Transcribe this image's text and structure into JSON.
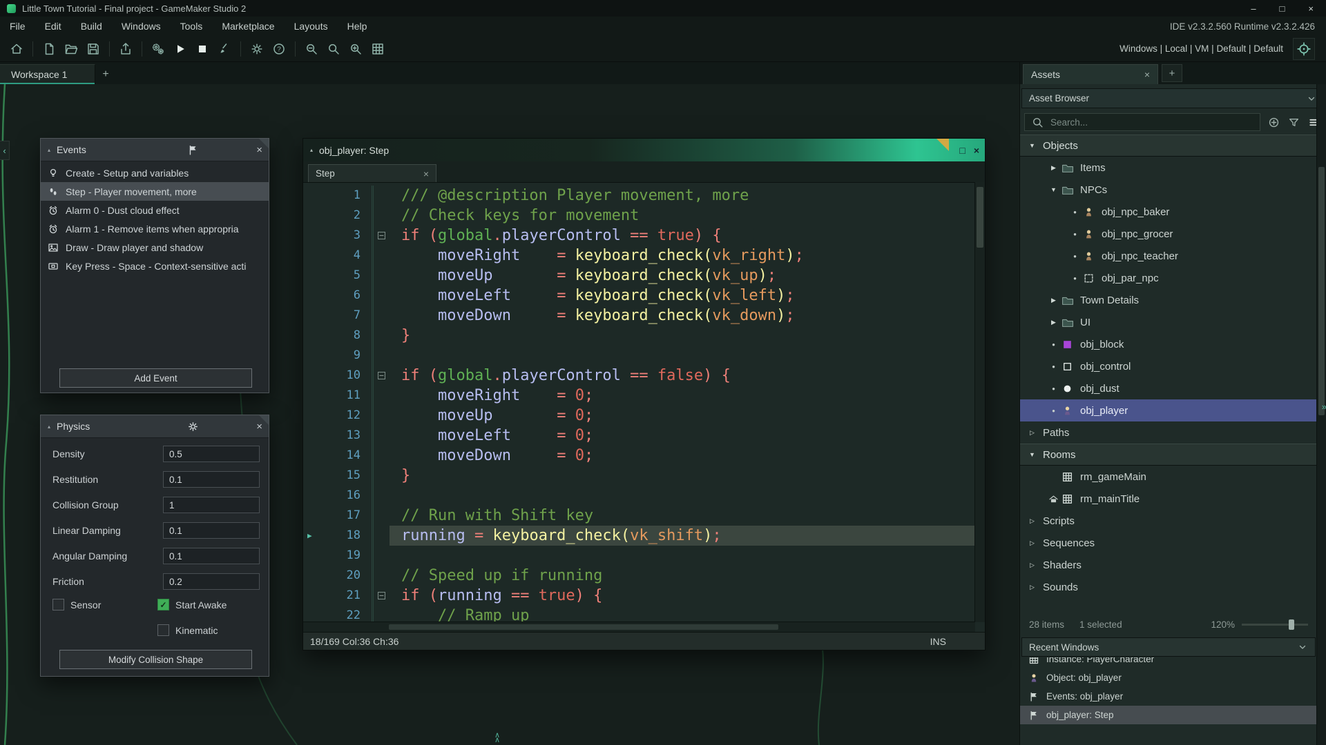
{
  "colors": {
    "accent_teal": "#2fbf97",
    "window_header_teal": "#2ec491",
    "fold_corner": "#d2a943",
    "selection_indigo": "#4a548c",
    "selection_gray": "#474d52",
    "checkbox_green": "#3fae57",
    "curve_green": "#3da15f"
  },
  "title_bar": {
    "title": "Little Town Tutorial - Final project - GameMaker Studio 2"
  },
  "menu_bar": {
    "items": [
      "File",
      "Edit",
      "Build",
      "Windows",
      "Tools",
      "Marketplace",
      "Layouts",
      "Help"
    ],
    "right_text": "IDE v2.3.2.560 Runtime v2.3.2.426"
  },
  "toolbar": {
    "groups": [
      [
        "home-icon"
      ],
      [
        "new-project-icon",
        "open-project-icon",
        "save-project-icon"
      ],
      [
        "export-icon"
      ],
      [
        "debug-gears-icon",
        "run-icon",
        "stop-icon",
        "clean-icon"
      ],
      [
        "settings-gear-icon",
        "help-icon"
      ],
      [
        "zoom-out-icon",
        "zoom-reset-icon",
        "zoom-in-icon",
        "room-editor-icon"
      ]
    ],
    "right_text": "Windows | Local | VM | Default | Default"
  },
  "workspace_tabs": {
    "active_tab": "Workspace 1",
    "add_label": "+"
  },
  "events_panel": {
    "title": "Events",
    "selected_index": 1,
    "items": [
      {
        "icon": "lightbulb-icon",
        "label": "Create - Setup and variables"
      },
      {
        "icon": "footsteps-icon",
        "label": "Step - Player movement, more"
      },
      {
        "icon": "alarm-icon",
        "label": "Alarm 0 - Dust cloud effect"
      },
      {
        "icon": "alarm-icon",
        "label": "Alarm 1 - Remove items when appropria"
      },
      {
        "icon": "draw-icon",
        "label": "Draw - Draw player and shadow"
      },
      {
        "icon": "keypress-icon",
        "label": "Key Press - Space - Context-sensitive acti"
      }
    ],
    "add_button": "Add Event"
  },
  "physics_panel": {
    "title": "Physics",
    "fields": [
      {
        "label": "Density",
        "value": "0.5"
      },
      {
        "label": "Restitution",
        "value": "0.1"
      },
      {
        "label": "Collision Group",
        "value": "1"
      },
      {
        "label": "Linear Damping",
        "value": "0.1"
      },
      {
        "label": "Angular Damping",
        "value": "0.1"
      },
      {
        "label": "Friction",
        "value": "0.2"
      }
    ],
    "checkboxes": [
      {
        "label": "Sensor",
        "checked": false
      },
      {
        "label": "Start Awake",
        "checked": true
      },
      {
        "label": "Kinematic",
        "checked": false
      }
    ],
    "modify_button": "Modify Collision Shape"
  },
  "code_window": {
    "title": "obj_player: Step",
    "tab_label": "Step",
    "status_left": "18/169 Col:36 Ch:36",
    "status_right": "INS",
    "current_line": 18,
    "syntax_colors": {
      "c": "#6fa24b",
      "k": "#ef8079",
      "g": "#5fb054",
      "v": "#b7bdf0",
      "b": "#e0695c",
      "f": "#f4f1a1",
      "o": "#e59a5e",
      "w": "#cfd8d4"
    },
    "lines": [
      {
        "n": 1,
        "segs": [
          [
            "c",
            "/// @description Player movement, more"
          ]
        ]
      },
      {
        "n": 2,
        "segs": [
          [
            "c",
            "// Check keys for movement"
          ]
        ]
      },
      {
        "n": 3,
        "fold": true,
        "segs": [
          [
            "k",
            "if ("
          ],
          [
            "g",
            "global"
          ],
          [
            "k",
            "."
          ],
          [
            "v",
            "playerControl"
          ],
          [
            "k",
            " == "
          ],
          [
            "b",
            "true"
          ],
          [
            "k",
            ") {"
          ]
        ]
      },
      {
        "n": 4,
        "segs": [
          [
            "w",
            "    "
          ],
          [
            "v",
            "moveRight"
          ],
          [
            "w",
            "    "
          ],
          [
            "k",
            "= "
          ],
          [
            "f",
            "keyboard_check("
          ],
          [
            "o",
            "vk_right"
          ],
          [
            "f",
            ")"
          ],
          [
            "k",
            ";"
          ]
        ]
      },
      {
        "n": 5,
        "segs": [
          [
            "w",
            "    "
          ],
          [
            "v",
            "moveUp"
          ],
          [
            "w",
            "       "
          ],
          [
            "k",
            "= "
          ],
          [
            "f",
            "keyboard_check("
          ],
          [
            "o",
            "vk_up"
          ],
          [
            "f",
            ")"
          ],
          [
            "k",
            ";"
          ]
        ]
      },
      {
        "n": 6,
        "segs": [
          [
            "w",
            "    "
          ],
          [
            "v",
            "moveLeft"
          ],
          [
            "w",
            "     "
          ],
          [
            "k",
            "= "
          ],
          [
            "f",
            "keyboard_check("
          ],
          [
            "o",
            "vk_left"
          ],
          [
            "f",
            ")"
          ],
          [
            "k",
            ";"
          ]
        ]
      },
      {
        "n": 7,
        "segs": [
          [
            "w",
            "    "
          ],
          [
            "v",
            "moveDown"
          ],
          [
            "w",
            "     "
          ],
          [
            "k",
            "= "
          ],
          [
            "f",
            "keyboard_check("
          ],
          [
            "o",
            "vk_down"
          ],
          [
            "f",
            ")"
          ],
          [
            "k",
            ";"
          ]
        ]
      },
      {
        "n": 8,
        "segs": [
          [
            "k",
            "}"
          ]
        ]
      },
      {
        "n": 9,
        "segs": []
      },
      {
        "n": 10,
        "fold": true,
        "segs": [
          [
            "k",
            "if ("
          ],
          [
            "g",
            "global"
          ],
          [
            "k",
            "."
          ],
          [
            "v",
            "playerControl"
          ],
          [
            "k",
            " == "
          ],
          [
            "b",
            "false"
          ],
          [
            "k",
            ") {"
          ]
        ]
      },
      {
        "n": 11,
        "segs": [
          [
            "w",
            "    "
          ],
          [
            "v",
            "moveRight"
          ],
          [
            "w",
            "    "
          ],
          [
            "k",
            "= "
          ],
          [
            "b",
            "0"
          ],
          [
            "k",
            ";"
          ]
        ]
      },
      {
        "n": 12,
        "segs": [
          [
            "w",
            "    "
          ],
          [
            "v",
            "moveUp"
          ],
          [
            "w",
            "       "
          ],
          [
            "k",
            "= "
          ],
          [
            "b",
            "0"
          ],
          [
            "k",
            ";"
          ]
        ]
      },
      {
        "n": 13,
        "segs": [
          [
            "w",
            "    "
          ],
          [
            "v",
            "moveLeft"
          ],
          [
            "w",
            "     "
          ],
          [
            "k",
            "= "
          ],
          [
            "b",
            "0"
          ],
          [
            "k",
            ";"
          ]
        ]
      },
      {
        "n": 14,
        "segs": [
          [
            "w",
            "    "
          ],
          [
            "v",
            "moveDown"
          ],
          [
            "w",
            "     "
          ],
          [
            "k",
            "= "
          ],
          [
            "b",
            "0"
          ],
          [
            "k",
            ";"
          ]
        ]
      },
      {
        "n": 15,
        "segs": [
          [
            "k",
            "}"
          ]
        ]
      },
      {
        "n": 16,
        "segs": []
      },
      {
        "n": 17,
        "segs": [
          [
            "c",
            "// Run with Shift key"
          ]
        ]
      },
      {
        "n": 18,
        "segs": [
          [
            "v",
            "running"
          ],
          [
            "k",
            " = "
          ],
          [
            "f",
            "keyboard_check("
          ],
          [
            "o",
            "vk_shift"
          ],
          [
            "f",
            ")"
          ],
          [
            "k",
            ";"
          ]
        ]
      },
      {
        "n": 19,
        "segs": []
      },
      {
        "n": 20,
        "segs": [
          [
            "c",
            "// Speed up if running"
          ]
        ]
      },
      {
        "n": 21,
        "fold": true,
        "segs": [
          [
            "k",
            "if ("
          ],
          [
            "v",
            "running"
          ],
          [
            "k",
            " == "
          ],
          [
            "b",
            "true"
          ],
          [
            "k",
            ") {"
          ]
        ]
      },
      {
        "n": 22,
        "segs": [
          [
            "w",
            "    "
          ],
          [
            "c",
            "// Ramp up"
          ]
        ]
      }
    ]
  },
  "assets_panel": {
    "tab_label": "Assets",
    "add_tab_label": "+",
    "dropdown_label": "Asset Browser",
    "search_placeholder": "Search...",
    "tree": [
      {
        "label": "Objects",
        "depth": 0,
        "kind": "section",
        "state": "expanded"
      },
      {
        "label": "Items",
        "depth": 1,
        "kind": "folder",
        "state": "collapsed",
        "icon": "folder-icon"
      },
      {
        "label": "NPCs",
        "depth": 1,
        "kind": "folder",
        "state": "expanded",
        "icon": "folder-icon"
      },
      {
        "label": "obj_npc_baker",
        "depth": 2,
        "kind": "object",
        "icon": "npc-sprite-icon"
      },
      {
        "label": "obj_npc_grocer",
        "depth": 2,
        "kind": "object",
        "icon": "npc-sprite-icon"
      },
      {
        "label": "obj_npc_teacher",
        "depth": 2,
        "kind": "object",
        "icon": "npc-sprite-icon"
      },
      {
        "label": "obj_par_npc",
        "depth": 2,
        "kind": "object",
        "icon": "blank-sprite-icon"
      },
      {
        "label": "Town Details",
        "depth": 1,
        "kind": "folder",
        "state": "collapsed",
        "icon": "folder-icon"
      },
      {
        "label": "UI",
        "depth": 1,
        "kind": "folder",
        "state": "collapsed",
        "icon": "folder-icon"
      },
      {
        "label": "obj_block",
        "depth": 1,
        "kind": "object",
        "icon": "purple-square-icon"
      },
      {
        "label": "obj_control",
        "depth": 1,
        "kind": "object",
        "icon": "outline-square-icon"
      },
      {
        "label": "obj_dust",
        "depth": 1,
        "kind": "object",
        "icon": "dust-icon"
      },
      {
        "label": "obj_player",
        "depth": 1,
        "kind": "object",
        "icon": "player-sprite-icon",
        "selected": true
      },
      {
        "label": "Paths",
        "depth": 0,
        "kind": "group",
        "state": "collapsed"
      },
      {
        "label": "Rooms",
        "depth": 0,
        "kind": "section",
        "state": "expanded"
      },
      {
        "label": "rm_gameMain",
        "depth": 1,
        "kind": "room",
        "icon": "room-grid-icon"
      },
      {
        "label": "rm_mainTitle",
        "depth": 1,
        "kind": "room",
        "icon": "room-grid-icon",
        "marker": "home-glyph-icon"
      },
      {
        "label": "Scripts",
        "depth": 0,
        "kind": "group",
        "state": "collapsed"
      },
      {
        "label": "Sequences",
        "depth": 0,
        "kind": "group",
        "state": "collapsed"
      },
      {
        "label": "Shaders",
        "depth": 0,
        "kind": "group",
        "state": "collapsed"
      },
      {
        "label": "Sounds",
        "depth": 0,
        "kind": "group",
        "state": "collapsed"
      }
    ],
    "footer": {
      "items_text": "28 items",
      "selected_text": "1 selected",
      "zoom_text": "120%"
    },
    "recent": {
      "header": "Recent Windows",
      "selected_index": 3,
      "items": [
        {
          "icon": "room-grid-icon",
          "label": "Instance: PlayerCharacter"
        },
        {
          "icon": "player-sprite-icon",
          "label": "Object: obj_player"
        },
        {
          "icon": "flag-icon",
          "label": "Events: obj_player"
        },
        {
          "icon": "flag-icon",
          "label": "obj_player: Step"
        }
      ]
    }
  }
}
